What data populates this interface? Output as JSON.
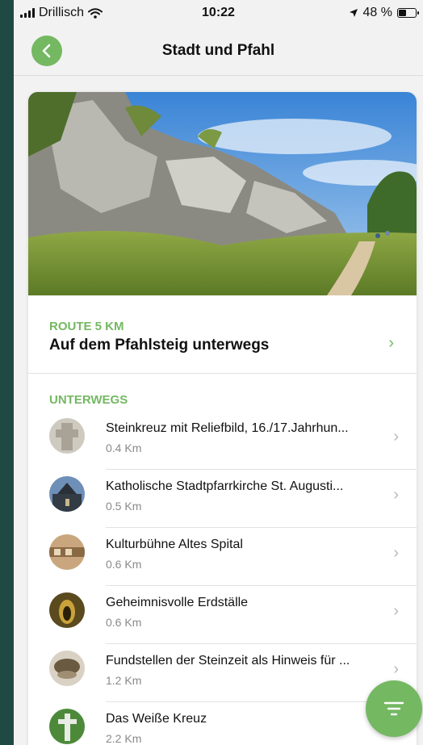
{
  "status_bar": {
    "carrier": "Drillisch",
    "time": "10:22",
    "battery": "48 %",
    "battery_level": 0.48
  },
  "header": {
    "title": "Stadt und Pfahl"
  },
  "route": {
    "kicker": "ROUTE 5 KM",
    "title": "Auf dem Pfahlsteig unterwegs"
  },
  "section": {
    "title": "UNTERWEGS"
  },
  "items": [
    {
      "title": "Steinkreuz mit Reliefbild, 16./17.Jahrhun...",
      "distance": "0.4 Km",
      "icon": "stone-cross-thumb"
    },
    {
      "title": "Katholische Stadtpfarrkirche St. Augusti...",
      "distance": "0.5 Km",
      "icon": "church-thumb"
    },
    {
      "title": "Kulturbühne Altes Spital",
      "distance": "0.6 Km",
      "icon": "building-thumb"
    },
    {
      "title": "Geheimnisvolle Erdställe",
      "distance": "0.6 Km",
      "icon": "tunnel-thumb"
    },
    {
      "title": "Fundstellen der Steinzeit als Hinweis für ...",
      "distance": "1.2 Km",
      "icon": "stone-artifact-thumb"
    },
    {
      "title": "Das Weiße Kreuz",
      "distance": "2.2 Km",
      "icon": "white-cross-thumb"
    }
  ],
  "colors": {
    "accent": "#74b862",
    "background": "#f2f2f2",
    "frame": "#1f4a43"
  }
}
